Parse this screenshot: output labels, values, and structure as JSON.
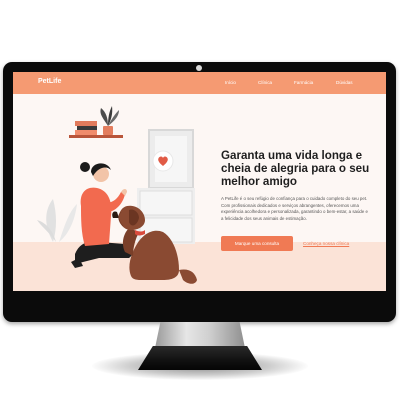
{
  "navbar": {
    "logo": "PetLife",
    "links": [
      "Início",
      "Clínica",
      "Farmácia",
      "Dúvidas"
    ]
  },
  "hero": {
    "title": "Garanta uma vida longa e cheia de alegria para o seu melhor amigo",
    "description": "A PetLife é o seu refúgio de confiança para o cuidado completo do seu pet. Com profissionais dedicados e serviços abrangentes, oferecemos uma experiência acolhedora e personalizada, garantindo o bem-estar, a saúde e a felicidade dos seus animais de estimação.",
    "primary_cta": "Marque uma consulta",
    "secondary_cta": "Conheça nossa clínica"
  },
  "colors": {
    "brand": "#f59a72",
    "accent": "#f07a54",
    "hero_background": "#fdf7f4"
  }
}
